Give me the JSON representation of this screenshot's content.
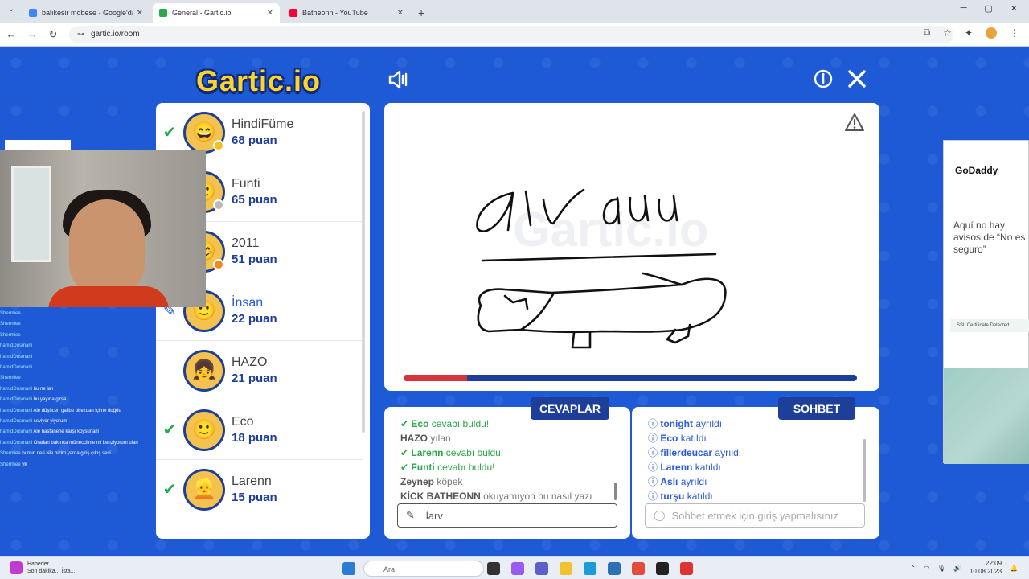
{
  "browser": {
    "tabs": [
      {
        "title": "balıkesir mobese - Google'da A",
        "fav_color": "#4285f4",
        "active": false
      },
      {
        "title": "General - Gartic.io",
        "fav_color": "#2aa84a",
        "active": true
      },
      {
        "title": "Batheonn - YouTube",
        "fav_color": "#ff0033",
        "active": false
      }
    ],
    "url": "gartic.io/room"
  },
  "game": {
    "logo": "Gartic.io",
    "players": [
      {
        "name": "HindiFüme",
        "score": "68 puan",
        "mark": "check",
        "emoji": "😄",
        "dot": "#f4c020"
      },
      {
        "name": "Funti",
        "score": "65 puan",
        "mark": "",
        "emoji": "🙂",
        "dot": "#bbbbbb"
      },
      {
        "name": "2011",
        "score": "51 puan",
        "mark": "",
        "emoji": "😊",
        "dot": "#f08a1c"
      },
      {
        "name": "İnsan",
        "score": "22 puan",
        "mark": "pencil",
        "emoji": "🙂",
        "dot": ""
      },
      {
        "name": "HAZO",
        "score": "21 puan",
        "mark": "",
        "emoji": "👧",
        "dot": ""
      },
      {
        "name": "Eco",
        "score": "18 puan",
        "mark": "check",
        "emoji": "🙂",
        "dot": ""
      },
      {
        "name": "Larenn",
        "score": "15 puan",
        "mark": "check",
        "emoji": "👱",
        "dot": ""
      }
    ],
    "timer_fraction": 0.14,
    "answers_label": "CEVAPLAR",
    "chat_label": "SOHBET",
    "answers": [
      {
        "who": "Eco",
        "text": "cevabı buldu!",
        "type": "ok"
      },
      {
        "who": "HAZO",
        "text": "yılan",
        "type": "guess"
      },
      {
        "who": "Larenn",
        "text": "cevabı buldu!",
        "type": "ok"
      },
      {
        "who": "Funti",
        "text": "cevabı buldu!",
        "type": "ok"
      },
      {
        "who": "Zeynep",
        "text": "köpek",
        "type": "guess"
      },
      {
        "who": "KİCK BATHEONN",
        "text": "okuyamıyon bu nasıl yazı",
        "type": "guess"
      }
    ],
    "answer_input_value": "larv",
    "chat": [
      {
        "who": "tonight",
        "text": "ayrıldı"
      },
      {
        "who": "Eco",
        "text": "katıldı"
      },
      {
        "who": "fillerdeucar",
        "text": "ayrıldı"
      },
      {
        "who": "Larenn",
        "text": "katıldı"
      },
      {
        "who": "Aslı",
        "text": "ayrıldı"
      },
      {
        "who": "turşu",
        "text": "katıldı"
      }
    ],
    "chat_placeholder": "Sohbet etmek için giriş yapmalısınız"
  },
  "stream_chat": [
    {
      "n": "Shermiee",
      "m": ""
    },
    {
      "n": "Shermiee",
      "m": ""
    },
    {
      "n": "Shermiee",
      "m": ""
    },
    {
      "n": "hamidDusmani",
      "m": ""
    },
    {
      "n": "hamidDusmani",
      "m": ""
    },
    {
      "n": "hamidDusmani",
      "m": ""
    },
    {
      "n": "Shermiee",
      "m": ""
    },
    {
      "n": "hamidDusmani",
      "m": "bu ne lan"
    },
    {
      "n": "hamidDusmani",
      "m": "bu yayına girsa"
    },
    {
      "n": "hamidDusmani",
      "m": "Ale düşücen galibe birezdan içime doğdu"
    },
    {
      "n": "hamidDusmani",
      "m": "seviyor yiyorum"
    },
    {
      "n": "hamidDusmani",
      "m": "Ale hastanene karşı koysunam"
    },
    {
      "n": "hamidDusmani",
      "m": "Oradan bakınca münecciime mi benziyorum ulan"
    },
    {
      "n": "Shermiee",
      "m": "bunun neri Nie bizim yarda giriş çıkış sesi"
    },
    {
      "n": "Shermiee",
      "m": "yk"
    }
  ],
  "ad": {
    "brand": "GoDaddy",
    "message": "Aquí no hay avisos de “No es seguro”",
    "ssl": "SSL Certificate Detected"
  },
  "taskbar": {
    "news_title": "Haberler",
    "news_sub": "Son dakika... İsta...",
    "search": "Ara",
    "time": "22:09",
    "date": "10.08.2023"
  }
}
